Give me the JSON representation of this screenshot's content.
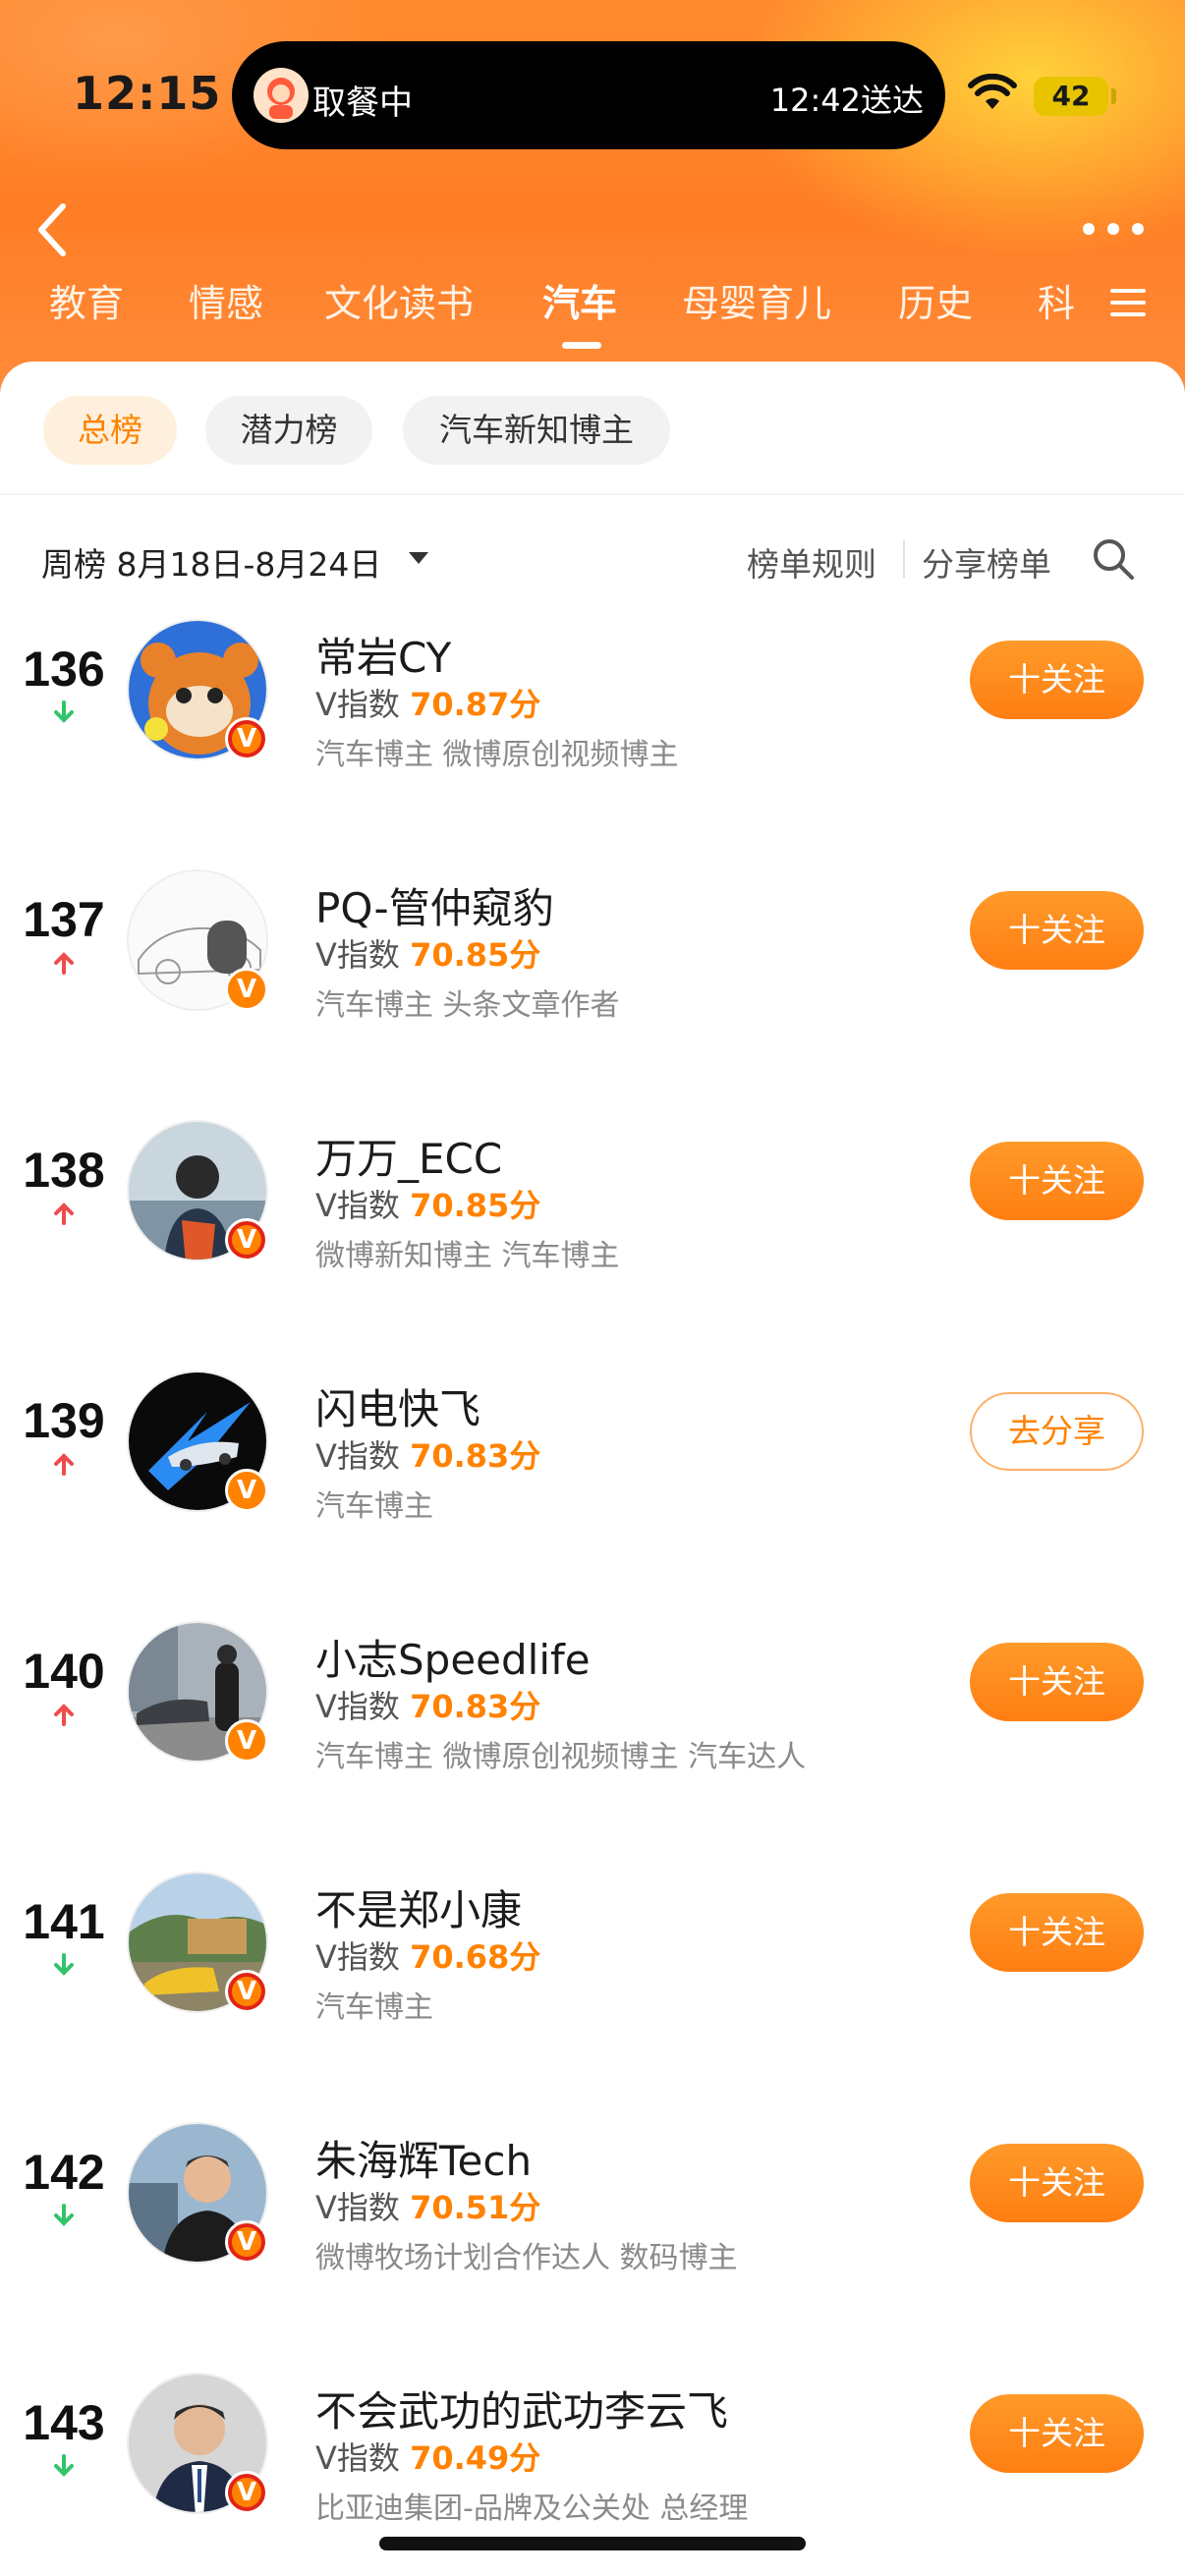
{
  "status_bar": {
    "time": "12:15",
    "activity_label": "取餐中",
    "activity_eta": "12:42送达",
    "battery": "42"
  },
  "nav": {
    "categories": [
      "教育",
      "情感",
      "文化读书",
      "汽车",
      "母婴育儿",
      "历史",
      "科"
    ],
    "active_category": "汽车"
  },
  "chips": [
    {
      "label": "总榜",
      "active": true
    },
    {
      "label": "潜力榜",
      "active": false
    },
    {
      "label": "汽车新知博主",
      "active": false
    }
  ],
  "toolbar": {
    "period": "周榜 8月18日-8月24日",
    "rules": "榜单规则",
    "share_list": "分享榜单"
  },
  "score_prefix": "V指数",
  "rows": [
    {
      "rank": "136",
      "trend": "down",
      "name": "常岩CY",
      "score": "70.87分",
      "tags": "汽车博主 微博原创视频博主",
      "button": "十关注",
      "button_type": "follow",
      "badge": "red"
    },
    {
      "rank": "137",
      "trend": "up",
      "name": "PQ-管仲窥豹",
      "score": "70.85分",
      "tags": "汽车博主 头条文章作者",
      "button": "十关注",
      "button_type": "follow",
      "badge": "orange"
    },
    {
      "rank": "138",
      "trend": "up",
      "name": "万万_ECC",
      "score": "70.85分",
      "tags": "微博新知博主 汽车博主",
      "button": "十关注",
      "button_type": "follow",
      "badge": "red"
    },
    {
      "rank": "139",
      "trend": "up",
      "name": "闪电快飞",
      "score": "70.83分",
      "tags": "汽车博主",
      "button": "去分享",
      "button_type": "share",
      "badge": "orange"
    },
    {
      "rank": "140",
      "trend": "up",
      "name": "小志Speedlife",
      "score": "70.83分",
      "tags": "汽车博主 微博原创视频博主 汽车达人",
      "button": "十关注",
      "button_type": "follow",
      "badge": "orange"
    },
    {
      "rank": "141",
      "trend": "down",
      "name": "不是郑小康",
      "score": "70.68分",
      "tags": "汽车博主",
      "button": "十关注",
      "button_type": "follow",
      "badge": "red"
    },
    {
      "rank": "142",
      "trend": "down",
      "name": "朱海辉Tech",
      "score": "70.51分",
      "tags": "微博牧场计划合作达人 数码博主",
      "button": "十关注",
      "button_type": "follow",
      "badge": "red"
    },
    {
      "rank": "143",
      "trend": "down",
      "name": "不会武功的武功李云飞",
      "score": "70.49分",
      "tags": "比亚迪集团-品牌及公关处 总经理",
      "button": "十关注",
      "button_type": "follow",
      "badge": "red"
    }
  ],
  "colors": {
    "accent": "#ff8200",
    "up": "#f04b4b",
    "down": "#33c46a"
  }
}
